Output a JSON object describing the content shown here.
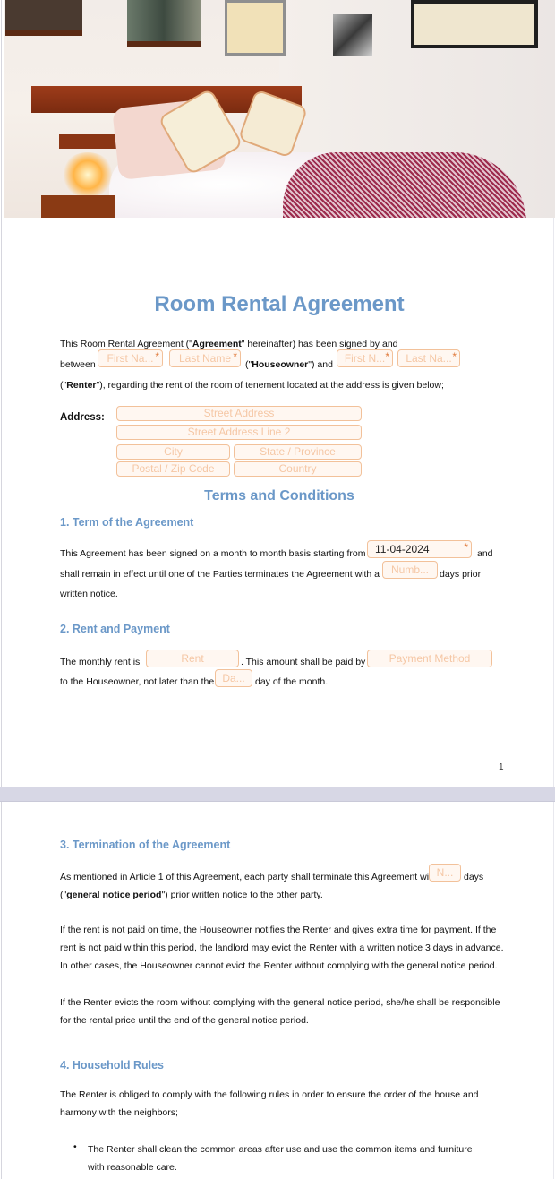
{
  "document": {
    "title": "Room Rental Agreement",
    "page_number": "1",
    "intro": {
      "line1_pre": "This Room Rental Agreement (\"",
      "line1_bold": "Agreement",
      "line1_post": "\" hereinafter) has been signed by and",
      "between": "between",
      "houseowner_pre": "(\"",
      "houseowner_bold": "Houseowner",
      "houseowner_post": "\") and",
      "line3_pre": "(\"",
      "line3_bold": "Renter",
      "line3_post": "\"), regarding the rent of the room of tenement located at the address is given below;"
    },
    "fields": {
      "owner_first": {
        "placeholder": "First Na...",
        "required": true
      },
      "owner_last": {
        "placeholder": "Last Name",
        "required": true
      },
      "renter_first": {
        "placeholder": "First N...",
        "required": true
      },
      "renter_last": {
        "placeholder": "Last Na...",
        "required": true
      }
    },
    "address": {
      "label": "Address:",
      "street": "Street Address",
      "street2": "Street Address Line 2",
      "city": "City",
      "state": "State / Province",
      "postal": "Postal / Zip Code",
      "country": "Country"
    },
    "terms_title": "Terms and Conditions",
    "sections": {
      "s1": {
        "title": "1. Term of the Agreement",
        "l1": "This Agreement has been signed on a month to month basis starting from",
        "start_date": "11-04-2024",
        "l1_end": "and",
        "l2": "shall remain in effect until one of the Parties terminates the Agreement with a",
        "days_placeholder": "Numb...",
        "l2_end": "days prior",
        "l3": "written notice."
      },
      "s2": {
        "title": "2. Rent and Payment",
        "l1": "The monthly rent is",
        "rent_placeholder": "Rent",
        "l1_mid": ". This amount shall be paid by",
        "method_placeholder": "Payment Method",
        "l2": "to the Houseowner, not later than the",
        "day_placeholder": "Da...",
        "l2_end": "day of the month."
      },
      "s3": {
        "title": "3. Termination of the Agreement",
        "l1": "As mentioned in Article 1 of this Agreement, each party shall terminate this Agreement with a",
        "notice_placeholder": "N...",
        "l1_end": "days",
        "l2_pre": "(\"",
        "l2_bold": "general notice period",
        "l2_post": "\") prior written notice to the other party.",
        "p2": "If the rent is not paid on time, the Houseowner notifies the Renter and gives extra time for payment. If the rent is not paid within this period, the landlord may evict the Renter with a written notice 3 days in advance. In other cases, the Houseowner cannot evict the Renter without complying with the  general notice period.",
        "p3": "If the Renter evicts the room without complying with the general notice period, she/he shall be responsible for the rental price until the end of the general notice period."
      },
      "s4": {
        "title": "4. Household Rules",
        "intro": "The Renter is obliged to comply with the following rules in order to ensure the order of the house and harmony with the neighbors;",
        "bullets": [
          "The Renter shall clean the common areas after use and use the common items and furniture with reasonable care."
        ]
      }
    },
    "colors": {
      "accent": "#6b98c8",
      "field_border": "#f2c19a",
      "field_placeholder": "#f5c7a5",
      "required_star": "#e07a3c"
    }
  }
}
